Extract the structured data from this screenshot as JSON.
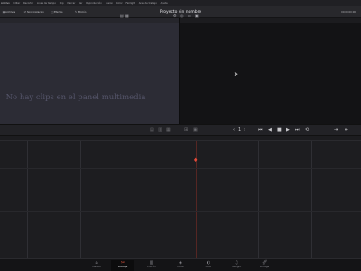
{
  "menubar": {
    "items": [
      "Archivo",
      "Editar",
      "Recortar",
      "Linea de tiempo",
      "Clip",
      "Marcar",
      "Ver",
      "Reproducción",
      "Fusion",
      "Color",
      "Fairlight",
      "Area de trabajo",
      "Ayuda"
    ]
  },
  "toolbar": {
    "media_pool": "Archivos",
    "sync": "Sincronización",
    "effects": "Efectos",
    "edit_index": "Edición",
    "project_title": "Proyecto sin nombre",
    "timecode": "00:00:00:00"
  },
  "media_pool": {
    "empty_message": "No hay clips en el panel multimedia"
  },
  "transport": {
    "clip_counter": "1",
    "prev_icon": "skip-back-icon",
    "play_icon": "play-icon"
  },
  "pages": [
    {
      "label": "Medios",
      "icon": "media-icon"
    },
    {
      "label": "Montaje",
      "icon": "cut-icon",
      "active": true
    },
    {
      "label": "Edición",
      "icon": "edit-icon"
    },
    {
      "label": "Fusion",
      "icon": "fusion-icon"
    },
    {
      "label": "Color",
      "icon": "color-icon"
    },
    {
      "label": "Fairlight",
      "icon": "fairlight-icon"
    },
    {
      "label": "Entrega",
      "icon": "deliver-icon"
    }
  ],
  "colors": {
    "accent": "#e4563f",
    "background": "#1a1a1c",
    "panel": "#2c2c35"
  }
}
